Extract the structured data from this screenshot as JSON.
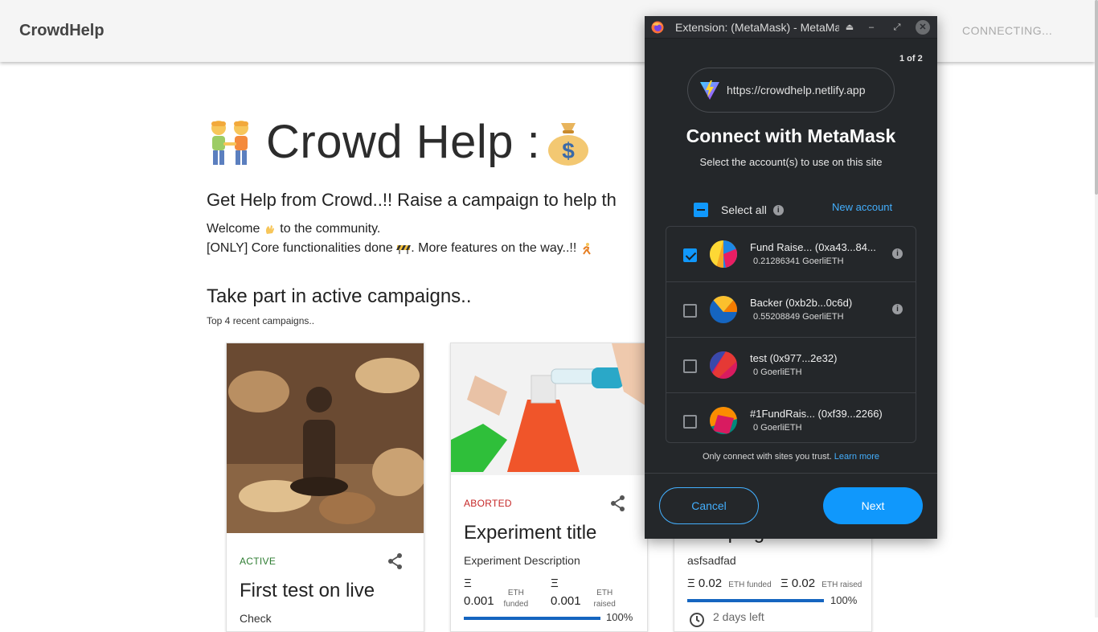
{
  "header": {
    "brand": "CrowdHelp",
    "status": "CONNECTING..."
  },
  "hero": {
    "title": "Crowd Help :",
    "subheading": "Get Help from Crowd..!! Raise a campaign to help th",
    "welcome_before": "Welcome ",
    "welcome_after": " to the community.",
    "core_before": "[ONLY] Core functionalities done ",
    "core_after": ". More features on the way..!! "
  },
  "campaigns": {
    "section_title": "Take part in active campaigns..",
    "section_sub": "Top 4 recent campaigns..",
    "cards": [
      {
        "status": "ACTIVE",
        "status_color": "#2e7d32",
        "title": "First test on live",
        "desc": "Check"
      },
      {
        "status": "ABORTED",
        "status_color": "#c62828",
        "title": "Experiment title",
        "desc": "Experiment Description",
        "funded_symbol": "Ξ",
        "funded_value": "0.001",
        "funded_label1": "ETH",
        "funded_label2": "funded",
        "raised_symbol": "Ξ",
        "raised_value": "0.001",
        "raised_label1": "ETH",
        "raised_label2": "raised",
        "progress_pct": 100,
        "percent_text": "100%"
      },
      {
        "title": "Campaign Success",
        "desc": "asfsadfad",
        "funded_value": "Ξ 0.02",
        "funded_label": "ETH funded",
        "raised_value": "Ξ 0.02",
        "raised_label": "ETH raised",
        "progress_pct": 100,
        "percent_text": "100%",
        "time_left": "2 days left"
      }
    ]
  },
  "metamask": {
    "window_title": "Extension: (MetaMask) - MetaMask",
    "page_count": "1 of 2",
    "origin_url": "https://crowdhelp.netlify.app",
    "heading": "Connect with MetaMask",
    "subheading": "Select the account(s) to use on this site",
    "select_all": "Select all",
    "new_account": "New account",
    "accounts": [
      {
        "name": "Fund Raise... (0xa43...84...",
        "balance": "0.21286341 GoerliETH",
        "checked": true
      },
      {
        "name": "Backer (0xb2b...0c6d)",
        "balance": "0.55208849 GoerliETH",
        "checked": false
      },
      {
        "name": "test (0x977...2e32)",
        "balance": "0 GoerliETH",
        "checked": false
      },
      {
        "name": "#1FundRais... (0xf39...2266)",
        "balance": "0 GoerliETH",
        "checked": false
      }
    ],
    "trust_text": "Only connect with sites you trust.",
    "learn_more": "Learn more",
    "cancel": "Cancel",
    "next": "Next",
    "accent": "#1098fc"
  }
}
